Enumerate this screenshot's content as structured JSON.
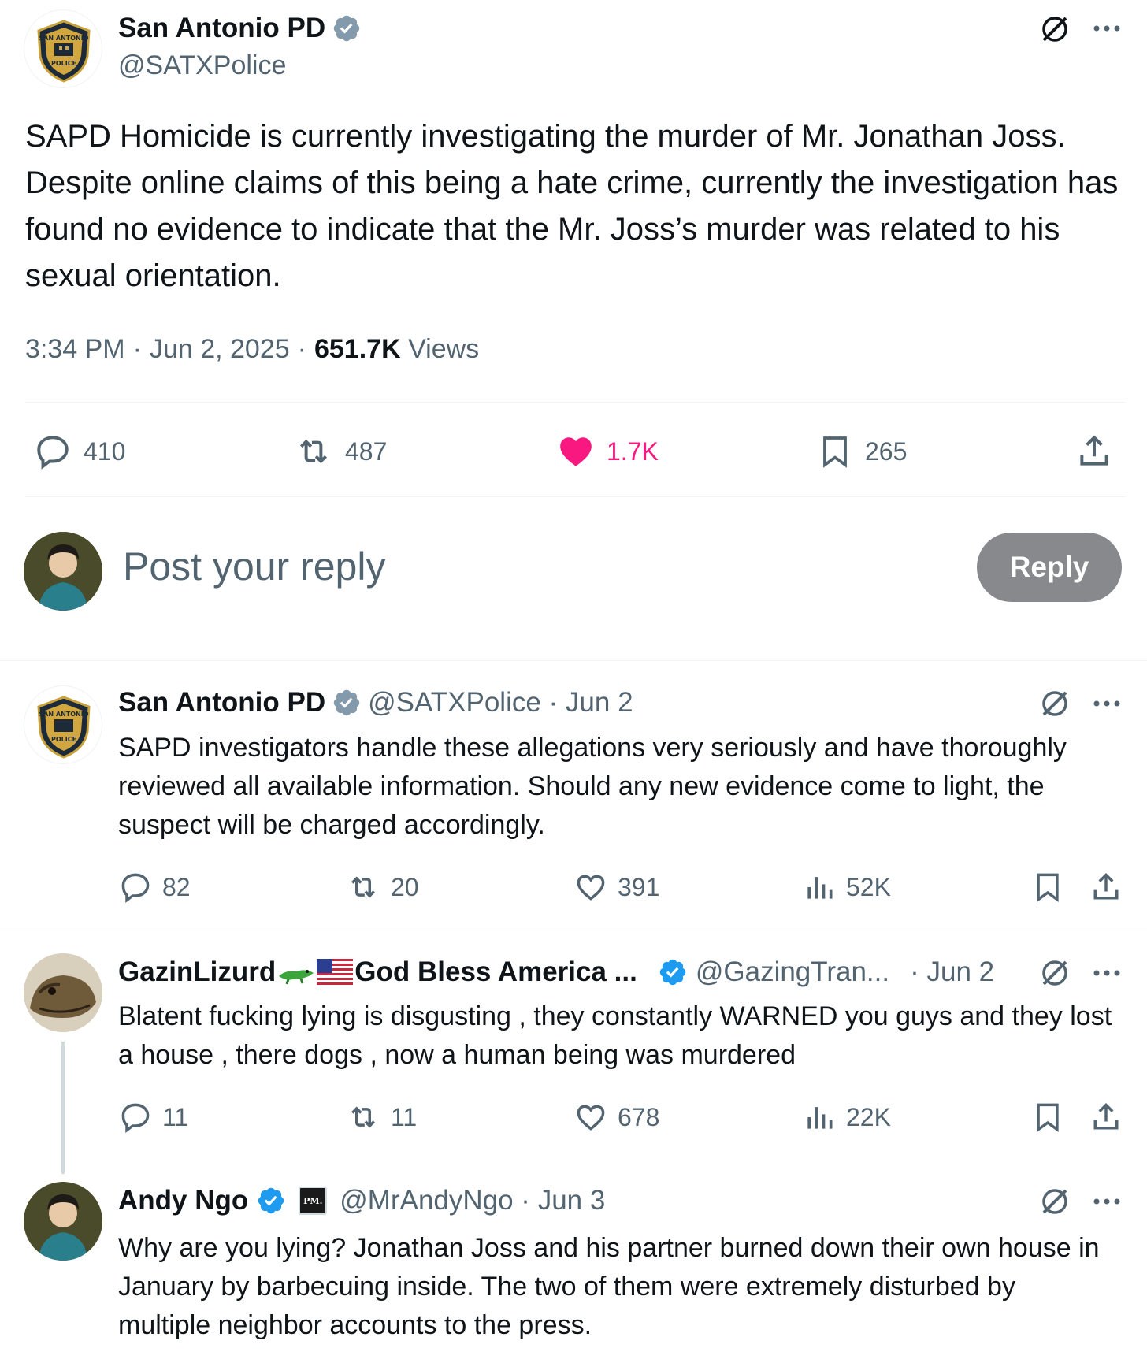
{
  "main_post": {
    "author_name": "San Antonio PD",
    "handle": "@SATXPolice",
    "text": "SAPD Homicide is currently investigating the murder of Mr. Jonathan Joss. Despite online claims of this being a hate crime, currently the investigation has found no evidence to indicate that the Mr. Joss’s murder was related to his sexual orientation.",
    "time": "3:34 PM",
    "sep1": "·",
    "date": "Jun 2, 2025",
    "sep2": "·",
    "views_count": "651.7K",
    "views_label": "Views",
    "replies": "410",
    "reposts": "487",
    "likes": "1.7K",
    "bookmarks": "265",
    "logo_text_top": "SAN ANTONIO",
    "logo_text_bottom": "POLICE"
  },
  "composer": {
    "placeholder": "Post your reply",
    "reply_button": "Reply"
  },
  "replies": [
    {
      "author_name": "San Antonio PD",
      "handle_date": "@SATXPolice · Jun 2",
      "text": "SAPD investigators handle these allegations very seriously and have thoroughly reviewed all available information. Should any new evidence come to light, the suspect will be charged accordingly.",
      "replies": "82",
      "reposts": "20",
      "likes": "391",
      "views": "52K"
    },
    {
      "author_name": "GazinLizurd",
      "author_name_2": "God Bless America ...",
      "handle": "@GazingTran...",
      "date": "· Jun 2",
      "text": "Blatent fucking lying is disgusting , they constantly WARNED you guys and they lost a house , there dogs , now a human being was murdered",
      "replies": "11",
      "reposts": "11",
      "likes": "678",
      "views": "22K"
    },
    {
      "author_name": "Andy Ngo",
      "org_badge": "PM.",
      "handle_date": "@MrAndyNgo · Jun 3",
      "text": "Why are you lying? Jonathan Joss and his partner burned down their own house in January by barbecuing inside. The two of them were extremely disturbed by multiple neighbor accounts to the press."
    }
  ],
  "colors": {
    "verified_blue": "#1d9bf0",
    "like_pink": "#f91880",
    "reply_button_bg": "#87898c",
    "secondary_text": "#536471"
  }
}
